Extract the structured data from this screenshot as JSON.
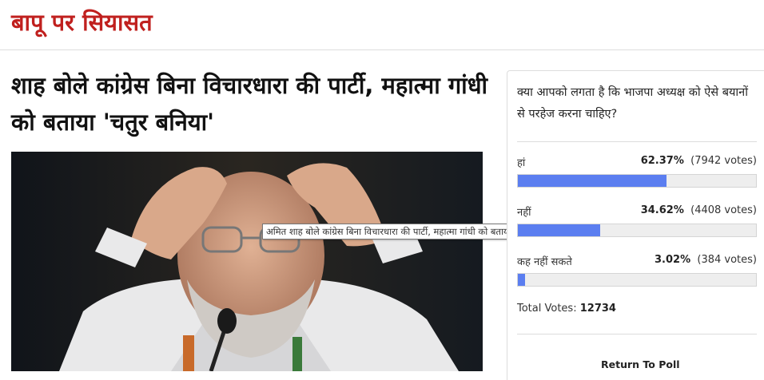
{
  "section": {
    "title": "बापू पर सियासत"
  },
  "article": {
    "headline": "शाह बोले कांग्रेस बिना विचारधारा की पार्टी, महात्मा गांधी को बताया 'चतुर बनिया'",
    "image_tooltip": "अमित शाह बोले कांग्रेस बिना विचारधारा की पार्टी, महात्मा गांधी को बताया 'चतुर बनिया'"
  },
  "poll": {
    "question": "क्या आपको लगता है कि भाजपा अध्यक्ष को ऐसे बयानों से परहेज करना चाहिए?",
    "options": [
      {
        "label": "हां",
        "percent": "62.37%",
        "votes": "(7942 votes)",
        "fraction": 0.6237
      },
      {
        "label": "नहीं",
        "percent": "34.62%",
        "votes": "(4408 votes)",
        "fraction": 0.3462
      },
      {
        "label": "कह नहीं सकते",
        "percent": "3.02%",
        "votes": "(384 votes)",
        "fraction": 0.0302
      }
    ],
    "total_label": "Total Votes:",
    "total_value": "12734",
    "return_label": "Return To Poll",
    "bar_color": "#5b7ef0"
  }
}
